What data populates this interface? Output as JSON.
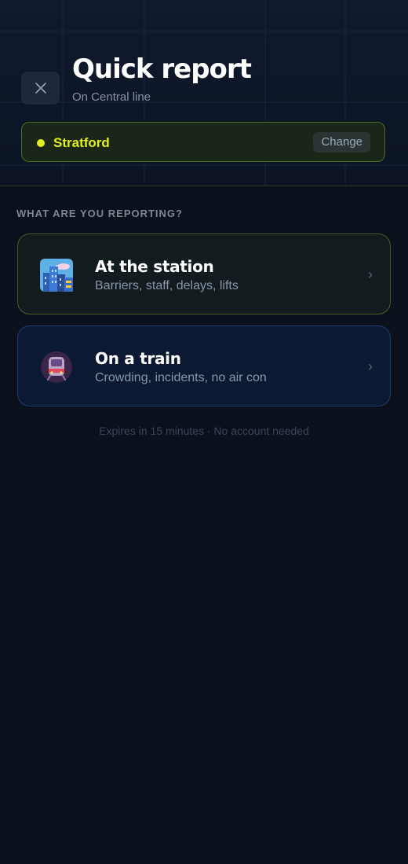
{
  "header": {
    "title": "Quick report",
    "subtitle": "On Central line",
    "close_icon": "close-icon"
  },
  "station": {
    "name": "Stratford",
    "change_label": "Change",
    "accent_color": "#e3f020"
  },
  "section": {
    "label": "WHAT ARE YOU REPORTING?"
  },
  "options": [
    {
      "title": "At the station",
      "subtitle": "Barriers, staff, delays, lifts",
      "icon": "city-buildings-icon",
      "border_color": "#4a5d24"
    },
    {
      "title": "On a train",
      "subtitle": "Crowding, incidents, no air con",
      "icon": "train-icon",
      "border_color": "#1f3d6a"
    }
  ],
  "footer": {
    "note": "Expires in 15 minutes · No account needed"
  }
}
